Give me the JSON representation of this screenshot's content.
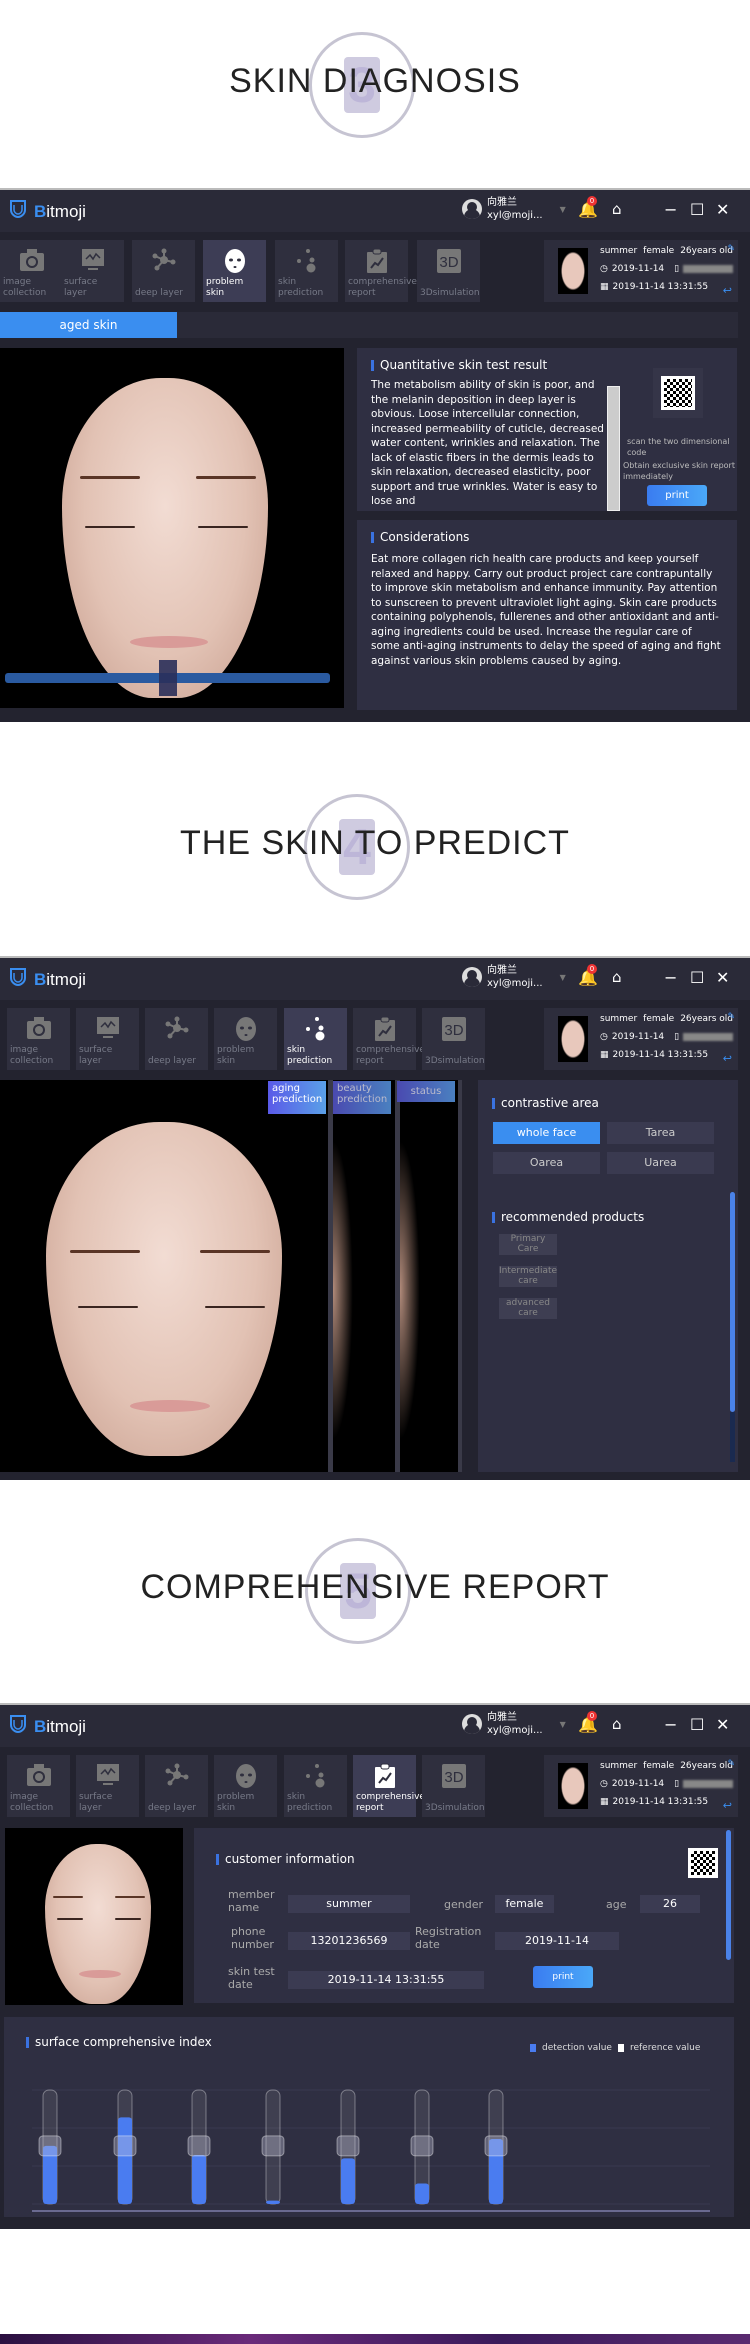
{
  "sections": [
    {
      "title": "SKIN DIAGNOSIS",
      "number": "3"
    },
    {
      "title": "THE SKIN TO PREDICT",
      "number": "4"
    },
    {
      "title": "COMPREHENSIVE REPORT",
      "number": "5"
    }
  ],
  "app": {
    "name_b": "B",
    "name_rest": "itmoji",
    "user_name": "向雅兰",
    "user_email": "xyl@moji...",
    "notification_count": "0",
    "nav": [
      {
        "label": "image collection",
        "icon": "camera-icon"
      },
      {
        "label": "surface layer",
        "icon": "monitor-icon"
      },
      {
        "label": "deep layer",
        "icon": "molecule-icon"
      },
      {
        "label": "problem skin",
        "icon": "face-mask-icon"
      },
      {
        "label": "skin prediction",
        "icon": "dots-icon"
      },
      {
        "label": "comprehensive report",
        "icon": "clipboard-chart-icon"
      },
      {
        "label": "3Dsimulation",
        "icon": "3d-icon"
      }
    ],
    "patient": {
      "name": "summer",
      "gender": "female",
      "age": "26years old",
      "date": "2019-11-14",
      "datetime": "2019-11-14 13:31:55"
    },
    "colors": {
      "accent": "#3a8ef0",
      "bg": "#23232f",
      "panel": "#2f2f42"
    }
  },
  "windows": [
    {
      "active_tab": 3
    },
    {
      "active_tab": 4
    },
    {
      "active_tab": 5
    }
  ],
  "problem_skin": {
    "subtab": "aged skin",
    "slider_value_percent": 50,
    "result_title": "Quantitative skin test result",
    "result_text": "The metabolism ability of skin is poor, and the melanin deposition in deep layer is obvious. Loose intercellular connection, increased permeability of cuticle, decreased water content, wrinkles and relaxation. The lack of elastic fibers in the dermis leads to skin relaxation, decreased elasticity, poor support and true wrinkles. Water is easy to lose and",
    "qr_caption1": "scan the two dimensional code",
    "qr_caption2": "Obtain exclusive skin report immediately",
    "print_label": "print",
    "considerations_title": "Considerations",
    "considerations_text": "Eat more collagen rich health care products and keep yourself relaxed and happy. Carry out product project care contrapuntally to improve skin metabolism and enhance immunity. Pay attention to sunscreen to prevent ultraviolet light aging. Skin care products containing polyphenols, fullerenes and other antioxidant and anti-aging ingredients could be used. Increase the regular care of some anti-aging instruments to delay the speed of aging and fight against various skin problems caused by aging."
  },
  "prediction": {
    "overlay_tabs": [
      "aging prediction",
      "beauty prediction",
      "status"
    ],
    "contrastive_title": "contrastive area",
    "areas": [
      {
        "label": "whole face",
        "selected": true
      },
      {
        "label": "Tarea",
        "selected": false
      },
      {
        "label": "Oarea",
        "selected": false
      },
      {
        "label": "Uarea",
        "selected": false
      }
    ],
    "products_title": "recommended products",
    "products": [
      "Primary Care",
      "Intermediate care",
      "advanced care"
    ]
  },
  "report": {
    "customer_title": "customer information",
    "member_name_label": "member name",
    "member_name": "summer",
    "gender_label": "gender",
    "gender": "female",
    "age_label": "age",
    "age": "26",
    "phone_label": "phone number",
    "phone": "13201236569",
    "reg_label": "Registration date",
    "reg_date": "2019-11-14",
    "test_label": "skin test date",
    "test_date": "2019-11-14 13:31:55",
    "print_label": "print"
  },
  "chart_data": {
    "type": "bar",
    "title": "surface comprehensive index",
    "legend": [
      {
        "name": "detection value",
        "color": "#4a7cf0"
      },
      {
        "name": "reference value",
        "color": "#ffffff"
      }
    ],
    "legend_position": "top-right",
    "ylim": [
      0,
      100
    ],
    "series": [
      {
        "name": "detection value",
        "values": [
          51,
          76,
          43,
          3,
          40,
          18,
          57
        ]
      },
      {
        "name": "reference value",
        "values": [
          51,
          51,
          51,
          51,
          51,
          51,
          51
        ]
      }
    ],
    "grid": true
  }
}
